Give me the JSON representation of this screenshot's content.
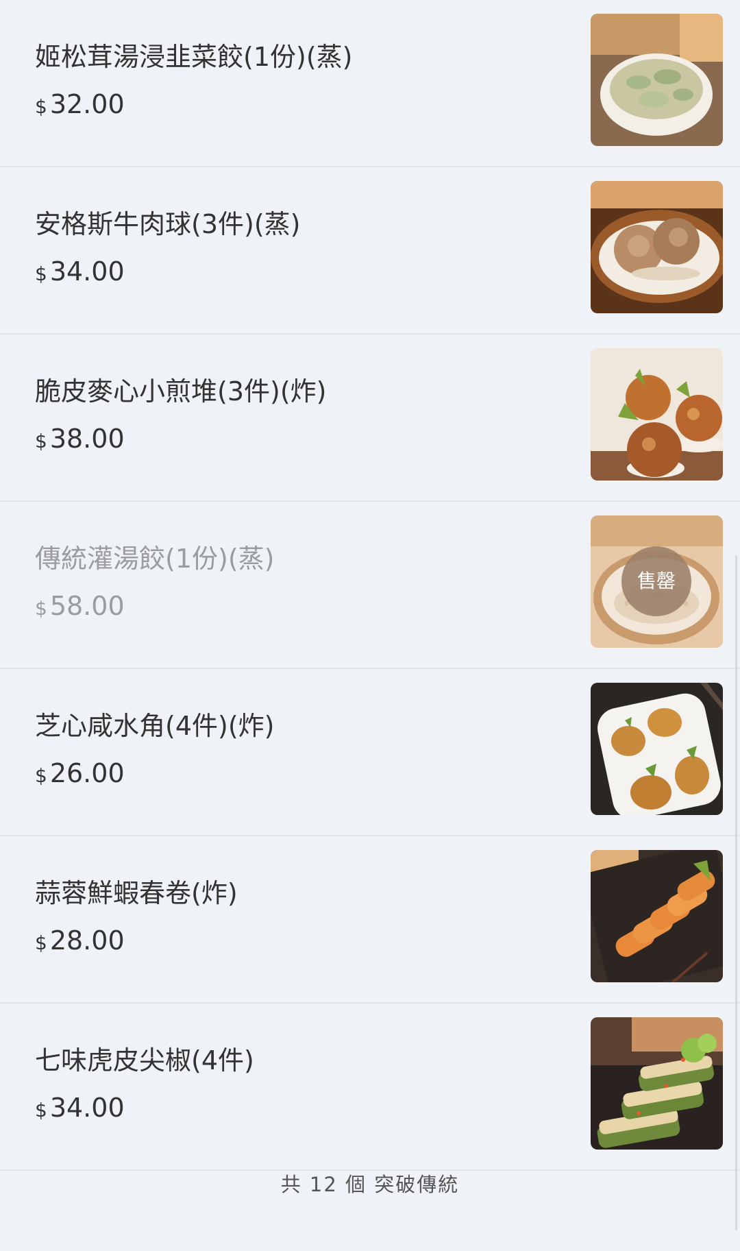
{
  "menu": {
    "items": [
      {
        "name": "姬松茸湯浸韭菜餃(1份)(蒸)",
        "currency": "$",
        "price": "32.00",
        "image": "dumplings-in-soup-bowl",
        "sold_out": false
      },
      {
        "name": "安格斯牛肉球(3件)(蒸)",
        "currency": "$",
        "price": "34.00",
        "image": "beef-balls-on-plate",
        "sold_out": false
      },
      {
        "name": "脆皮麥心小煎堆(3件)(炸)",
        "currency": "$",
        "price": "38.00",
        "image": "sesame-balls",
        "sold_out": false
      },
      {
        "name": "傳統灌湯餃(1份)(蒸)",
        "currency": "$",
        "price": "58.00",
        "image": "soup-dumpling-bowl",
        "sold_out": true,
        "badge": "售罄"
      },
      {
        "name": "芝心咸水角(4件)(炸)",
        "currency": "$",
        "price": "26.00",
        "image": "fried-dumplings-on-plate",
        "sold_out": false
      },
      {
        "name": "蒜蓉鮮蝦春卷(炸)",
        "currency": "$",
        "price": "28.00",
        "image": "spring-rolls",
        "sold_out": false
      },
      {
        "name": "七味虎皮尖椒(4件)",
        "currency": "$",
        "price": "34.00",
        "image": "stuffed-peppers",
        "sold_out": false
      }
    ]
  },
  "footer": {
    "text": "共 12 個 突破傳統"
  }
}
